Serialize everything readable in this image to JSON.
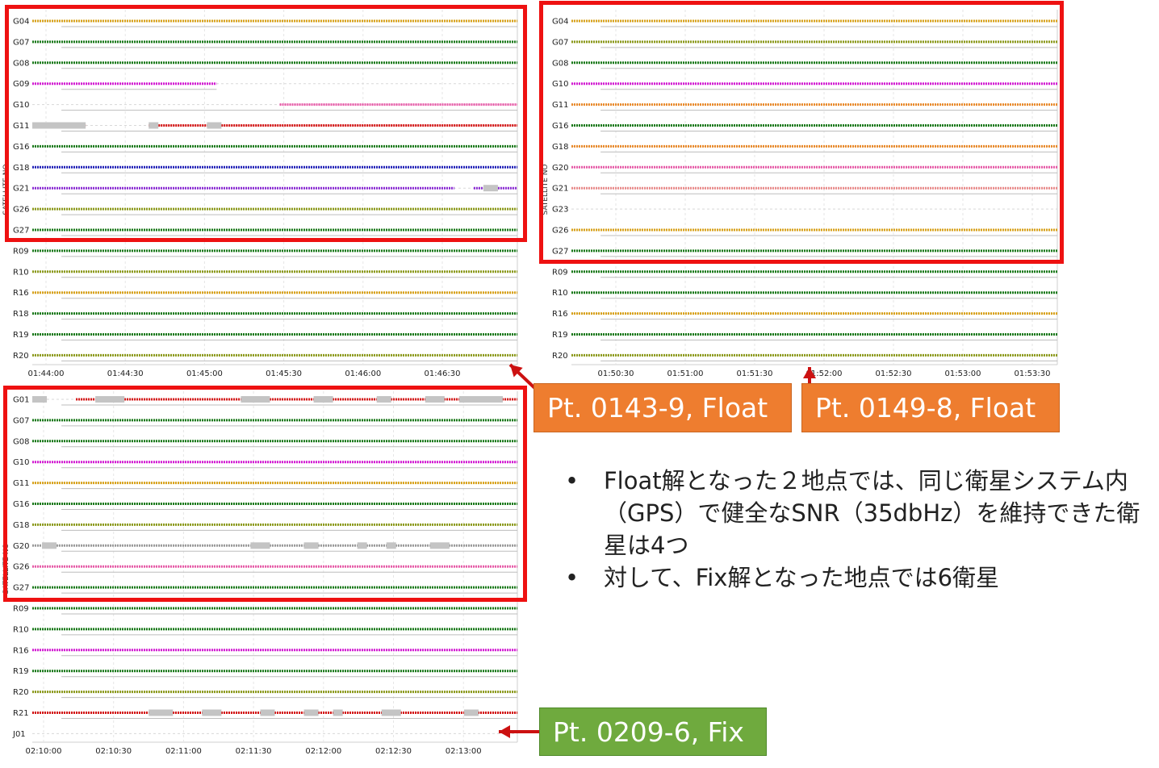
{
  "colors": {
    "frame_red": "#ee1111",
    "callout_orange": "#ee7d2f",
    "callout_green": "#6faa3e",
    "arrow_red": "#cc1111",
    "snr_colors": [
      "#1a7a1a",
      "#8c9a1a",
      "#d9a21a",
      "#ea8a2a",
      "#e85aa8",
      "#d41ad4",
      "#2020b8",
      "#d41414",
      "#9a9a9a"
    ]
  },
  "chart_data": [
    {
      "type": "timeline",
      "panel": "Pt. 0143-9, Float",
      "ylabel": "SATELLITE NO",
      "x_ticks": [
        "01:44:00",
        "01:44:30",
        "01:45:00",
        "01:45:30",
        "01:46:00",
        "01:46:30"
      ],
      "satellites": [
        {
          "id": "G04",
          "color": "#d9a21a",
          "start": 0,
          "end": 1
        },
        {
          "id": "G07",
          "color": "#1a7a1a",
          "start": 0,
          "end": 1
        },
        {
          "id": "G08",
          "color": "#1a7a1a",
          "start": 0,
          "end": 1
        },
        {
          "id": "G09",
          "color": "#d41ad4",
          "start": 0,
          "end": 0.38
        },
        {
          "id": "G10",
          "color": "#e85aa8",
          "start": 0.51,
          "end": 1
        },
        {
          "id": "G11",
          "color": "#d41414",
          "start": 0,
          "end": 1,
          "gaps": [
            [
              0.11,
              0.24
            ]
          ],
          "degraded": [
            [
              0.0,
              0.11
            ],
            [
              0.24,
              0.26
            ],
            [
              0.36,
              0.39
            ]
          ]
        },
        {
          "id": "G16",
          "color": "#1a7a1a",
          "start": 0,
          "end": 1
        },
        {
          "id": "G18",
          "color": "#2020b8",
          "start": 0,
          "end": 1
        },
        {
          "id": "G21",
          "color": "#8a2ad4",
          "start": 0,
          "end": 1,
          "gaps": [
            [
              0.87,
              0.91
            ]
          ],
          "degraded": [
            [
              0.93,
              0.96
            ]
          ]
        },
        {
          "id": "G26",
          "color": "#8c9a1a",
          "start": 0,
          "end": 1
        },
        {
          "id": "G27",
          "color": "#1a7a1a",
          "start": 0,
          "end": 1
        },
        {
          "id": "R09",
          "color": "#1a7a1a",
          "start": 0,
          "end": 1
        },
        {
          "id": "R10",
          "color": "#8c9a1a",
          "start": 0,
          "end": 1
        },
        {
          "id": "R16",
          "color": "#d9a21a",
          "start": 0,
          "end": 1
        },
        {
          "id": "R18",
          "color": "#1a7a1a",
          "start": 0,
          "end": 1
        },
        {
          "id": "R19",
          "color": "#1a7a1a",
          "start": 0,
          "end": 1
        },
        {
          "id": "R20",
          "color": "#8c9a1a",
          "start": 0,
          "end": 1
        }
      ]
    },
    {
      "type": "timeline",
      "panel": "Pt. 0149-8, Float",
      "ylabel": "SATELLITE NO",
      "x_ticks": [
        "01:50:30",
        "01:51:00",
        "01:51:30",
        "01:52:00",
        "01:52:30",
        "01:53:00",
        "01:53:30"
      ],
      "satellites": [
        {
          "id": "G04",
          "color": "#d9a21a",
          "start": 0,
          "end": 1
        },
        {
          "id": "G07",
          "color": "#8c9a1a",
          "start": 0,
          "end": 1
        },
        {
          "id": "G08",
          "color": "#1a7a1a",
          "start": 0,
          "end": 1
        },
        {
          "id": "G10",
          "color": "#d41ad4",
          "start": 0,
          "end": 1
        },
        {
          "id": "G11",
          "color": "#ea8a2a",
          "start": 0,
          "end": 1
        },
        {
          "id": "G16",
          "color": "#1a7a1a",
          "start": 0,
          "end": 1
        },
        {
          "id": "G18",
          "color": "#ea8a2a",
          "start": 0,
          "end": 1
        },
        {
          "id": "G20",
          "color": "#e85aa8",
          "start": 0,
          "end": 1
        },
        {
          "id": "G21",
          "color": "#ea8a8a",
          "start": 0,
          "end": 1
        },
        {
          "id": "G23",
          "color": "#ffffff",
          "start": 0,
          "end": 0
        },
        {
          "id": "G26",
          "color": "#d9a21a",
          "start": 0,
          "end": 1
        },
        {
          "id": "G27",
          "color": "#1a7a1a",
          "start": 0,
          "end": 1
        },
        {
          "id": "R09",
          "color": "#1a7a1a",
          "start": 0,
          "end": 1
        },
        {
          "id": "R10",
          "color": "#1a7a1a",
          "start": 0,
          "end": 1
        },
        {
          "id": "R16",
          "color": "#d9a21a",
          "start": 0,
          "end": 1
        },
        {
          "id": "R19",
          "color": "#1a7a1a",
          "start": 0,
          "end": 1
        },
        {
          "id": "R20",
          "color": "#8c9a1a",
          "start": 0,
          "end": 1
        }
      ]
    },
    {
      "type": "timeline",
      "panel": "Pt. 0209-6, Fix",
      "ylabel": "SATELLITE NO",
      "x_ticks": [
        "02:10:00",
        "02:10:30",
        "02:11:00",
        "02:11:30",
        "02:12:00",
        "02:12:30",
        "02:13:00"
      ],
      "satellites": [
        {
          "id": "G01",
          "color": "#d41414",
          "start": 0,
          "end": 1,
          "gaps": [
            [
              0.03,
              0.09
            ]
          ],
          "degraded": [
            [
              0.0,
              0.03
            ],
            [
              0.13,
              0.19
            ],
            [
              0.43,
              0.49
            ],
            [
              0.58,
              0.62
            ],
            [
              0.71,
              0.74
            ],
            [
              0.81,
              0.85
            ],
            [
              0.88,
              0.97
            ]
          ]
        },
        {
          "id": "G07",
          "color": "#1a7a1a",
          "start": 0,
          "end": 1
        },
        {
          "id": "G08",
          "color": "#1a7a1a",
          "start": 0,
          "end": 1
        },
        {
          "id": "G10",
          "color": "#d41ad4",
          "start": 0,
          "end": 1
        },
        {
          "id": "G11",
          "color": "#d9a21a",
          "start": 0,
          "end": 1
        },
        {
          "id": "G16",
          "color": "#1a7a1a",
          "start": 0,
          "end": 1
        },
        {
          "id": "G18",
          "color": "#8c9a1a",
          "start": 0,
          "end": 1
        },
        {
          "id": "G20",
          "color": "#9a9a9a",
          "start": 0,
          "end": 1,
          "degraded": [
            [
              0.02,
              0.05
            ],
            [
              0.45,
              0.49
            ],
            [
              0.56,
              0.59
            ],
            [
              0.67,
              0.69
            ],
            [
              0.73,
              0.75
            ],
            [
              0.82,
              0.86
            ]
          ]
        },
        {
          "id": "G26",
          "color": "#e85aa8",
          "start": 0,
          "end": 1
        },
        {
          "id": "G27",
          "color": "#1a7a1a",
          "start": 0,
          "end": 1
        },
        {
          "id": "R09",
          "color": "#1a7a1a",
          "start": 0,
          "end": 1
        },
        {
          "id": "R10",
          "color": "#1a7a1a",
          "start": 0,
          "end": 1
        },
        {
          "id": "R16",
          "color": "#d41ad4",
          "start": 0,
          "end": 1
        },
        {
          "id": "R19",
          "color": "#1a7a1a",
          "start": 0,
          "end": 1
        },
        {
          "id": "R20",
          "color": "#8c9a1a",
          "start": 0,
          "end": 1
        },
        {
          "id": "R21",
          "color": "#d41414",
          "start": 0,
          "end": 1,
          "degraded": [
            [
              0.24,
              0.29
            ],
            [
              0.35,
              0.39
            ],
            [
              0.47,
              0.5
            ],
            [
              0.56,
              0.59
            ],
            [
              0.62,
              0.64
            ],
            [
              0.72,
              0.76
            ],
            [
              0.89,
              0.92
            ]
          ]
        },
        {
          "id": "J01",
          "color": "#ffffff",
          "start": 0,
          "end": 0
        }
      ]
    }
  ],
  "callouts": [
    {
      "text": "Pt. 0143-9, Float"
    },
    {
      "text": "Pt. 0149-8, Float"
    },
    {
      "text": "Pt. 0209-6, Fix"
    }
  ],
  "notes": {
    "bullet_1": "Float解となった２地点では、同じ衛星システム内（GPS）で健全なSNR（35dbHz）を維持できた衛星は4つ",
    "bullet_2": "対して、Fix解となった地点では6衛星",
    "bullet_symbol": "•"
  }
}
